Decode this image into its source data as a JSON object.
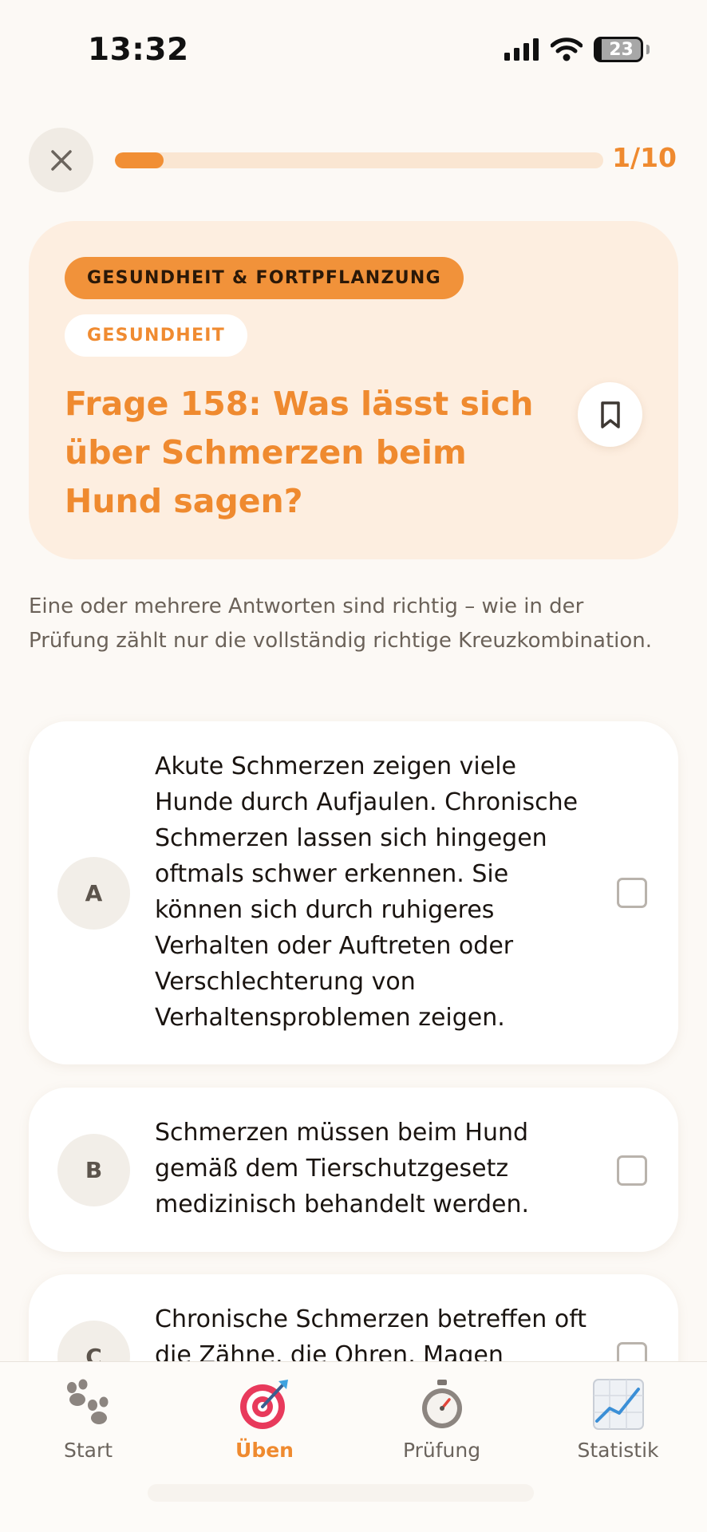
{
  "status_bar": {
    "time": "13:32",
    "battery": "23"
  },
  "header": {
    "progress_fraction": 0.1,
    "progress_label": "1/10"
  },
  "question": {
    "category": "GESUNDHEIT & FORTPFLANZUNG",
    "subcategory": "GESUNDHEIT",
    "title": "Frage 158: Was lässt sich über Schmerzen beim Hund sagen?"
  },
  "instructions": "Eine oder mehrere Antworten sind richtig – wie in der Prüfung zählt nur die vollständig richtige Kreuzkombination.",
  "answers": [
    {
      "letter": "A",
      "text": "Akute Schmerzen zeigen viele Hunde durch Aufjaulen. Chronische Schmerzen lassen sich hingegen oftmals schwer erkennen. Sie können sich durch ruhigeres Verhalten oder Auftreten oder Verschlechterung von Verhaltensproblemen zeigen.",
      "checked": false
    },
    {
      "letter": "B",
      "text": "Schmerzen müssen beim Hund gemäß dem Tierschutzgesetz medizinisch behandelt werden.",
      "checked": false
    },
    {
      "letter": "C",
      "text": "Chronische Schmerzen betreffen oft die Zähne, die Ohren, Magen",
      "checked": false
    }
  ],
  "tabs": [
    {
      "label": "Start",
      "icon": "paw-icon"
    },
    {
      "label": "Üben",
      "icon": "target-icon",
      "active": true
    },
    {
      "label": "Prüfung",
      "icon": "stopwatch-icon"
    },
    {
      "label": "Statistik",
      "icon": "chart-icon"
    }
  ],
  "colors": {
    "accent": "#ef8a2f",
    "background": "#fcf9f5",
    "card": "#fdeee0"
  }
}
